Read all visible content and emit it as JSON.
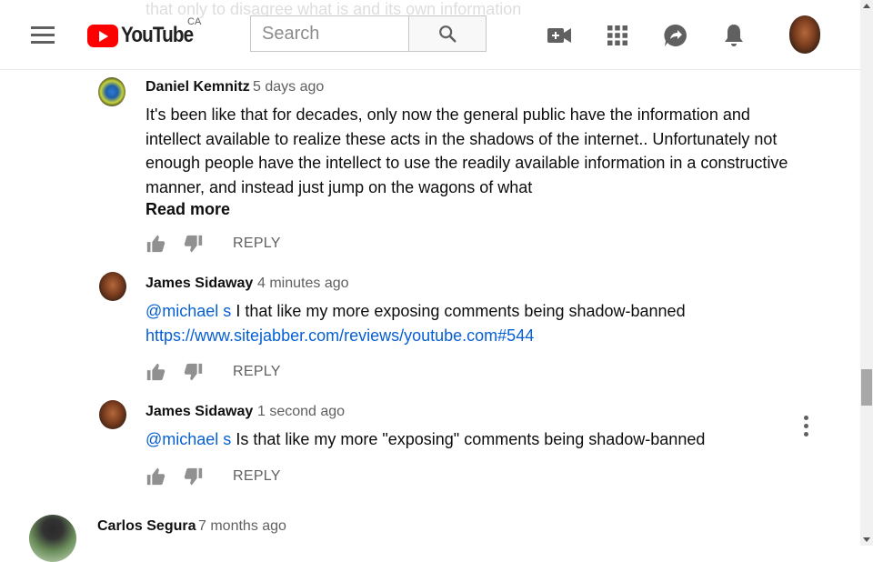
{
  "header": {
    "logo_text": "YouTube",
    "logo_region": "CA",
    "ghost_text": "that only to disagree what is and its own information",
    "search": {
      "placeholder": "Search"
    }
  },
  "comments": [
    {
      "author": "Daniel Kemnitz",
      "time": "5 days ago",
      "text": "It's been like that for decades, only now the general public have the information and intellect available to realize these acts in the shadows of the internet.. Unfortunately not enough people have the intellect to use the readily available information in a constructive manner, and instead just jump on the wagons of what",
      "read_more": "Read more",
      "reply": "REPLY"
    },
    {
      "author": "James Sidaway",
      "time": "4 minutes ago",
      "mention": "@michael s",
      "text": " I that like my more exposing comments being shadow-banned",
      "url": "https://www.sitejabber.com/reviews/youtube.com#544",
      "reply": "REPLY"
    },
    {
      "author": "James Sidaway",
      "time": "1 second ago",
      "mention": "@michael s",
      "text": " Is that like my more \"exposing\" comments being shadow-banned",
      "reply": "REPLY"
    },
    {
      "author": "Carlos Segura",
      "time": "7 months ago"
    }
  ],
  "icons": {
    "menu": "hamburger-menu-icon",
    "search": "search-icon",
    "create": "video-camera-plus-icon",
    "apps": "apps-grid-icon",
    "messages": "share-arrow-bubble-icon",
    "notifications": "bell-icon",
    "like": "thumbs-up-icon",
    "dislike": "thumbs-down-icon",
    "more": "kebab-menu-icon"
  },
  "colors": {
    "brand_red": "#ff0000",
    "link_blue": "#065fd4",
    "icon_gray": "#606060"
  }
}
